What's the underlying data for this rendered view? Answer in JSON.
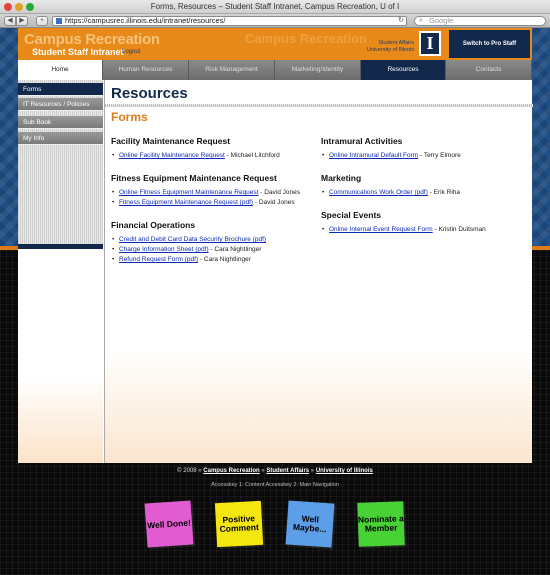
{
  "browser": {
    "window_title": "Forms, Resources – Student Staff Intranet, Campus Recreation, U of I",
    "url": "https://campusrec.illinois.edu/intranet/resources/",
    "search_placeholder": "Google"
  },
  "header": {
    "title": "Campus Recreation",
    "subtitle": "Student Staff Intranet",
    "logout": "Logout",
    "right_title": "Campus Recreation",
    "affiliation_line1": "Student Affairs",
    "affiliation_line2": "University of Illinois",
    "logo_letter": "I",
    "pro_staff_button": "Switch to Pro Staff"
  },
  "tabs": [
    {
      "label": "Home"
    },
    {
      "label": "Human Resources"
    },
    {
      "label": "Risk Management"
    },
    {
      "label": "Marketing/Identity"
    },
    {
      "label": "Resources"
    },
    {
      "label": "Contacts"
    }
  ],
  "sidebar": {
    "items": [
      {
        "label": "Forms"
      },
      {
        "label": "IT Resources / Policies"
      },
      {
        "label": "Sub Book"
      },
      {
        "label": "My Info"
      }
    ]
  },
  "main": {
    "page_title": "Resources",
    "section_title": "Forms",
    "left_groups": [
      {
        "title": "Facility Maintenance Request",
        "items": [
          {
            "link": "Online Facility Maintenance Request",
            "contact": " - Michael Litchford"
          }
        ]
      },
      {
        "title": "Fitness Equipment Maintenance Request",
        "items": [
          {
            "link": "Online Fitness Equipment Maintenance Request",
            "contact": " - David Jones"
          },
          {
            "link": "Fitness Equipment Maintenance Request (pdf)",
            "contact": " - David Jones"
          }
        ]
      },
      {
        "title": "Financial Operations",
        "items": [
          {
            "link": "Credit and Debit Card Data Security Brochure (pdf)",
            "contact": ""
          },
          {
            "link": "Charge Information Sheet (pdf)",
            "contact": " - Cara Nightlinger"
          },
          {
            "link": "Refund Request Form (pdf)",
            "contact": " - Cara Nightlinger"
          }
        ]
      }
    ],
    "right_groups": [
      {
        "title": "Intramural Activities",
        "items": [
          {
            "link": "Online Intramural Default Form",
            "contact": " - Terry Elmore"
          }
        ]
      },
      {
        "title": "Marketing",
        "items": [
          {
            "link": "Communications Work Order (pdf)",
            "contact": " - Erik Riha"
          }
        ]
      },
      {
        "title": "Special Events",
        "items": [
          {
            "link": "Online Internal Event Request Form",
            "contact": " - Kristin Duitsman"
          }
        ]
      }
    ]
  },
  "footer": {
    "copyright_prefix": "© 2008 »",
    "link_campus_rec": "Campus Recreation",
    "sep1": "»",
    "link_student_affairs": "Student Affairs",
    "sep2": "»",
    "link_university": "University of Illinois",
    "accesskeys": "Accesskey 1: Content      Accesskey 2: Main Navigation"
  },
  "notes": [
    {
      "label": "Well Done!",
      "color": "#e25cd1"
    },
    {
      "label": "Positive Comment",
      "color": "#f4e60f"
    },
    {
      "label": "Well Maybe...",
      "color": "#5d9ee8"
    },
    {
      "label": "Nominate a Member",
      "color": "#48d236"
    }
  ]
}
